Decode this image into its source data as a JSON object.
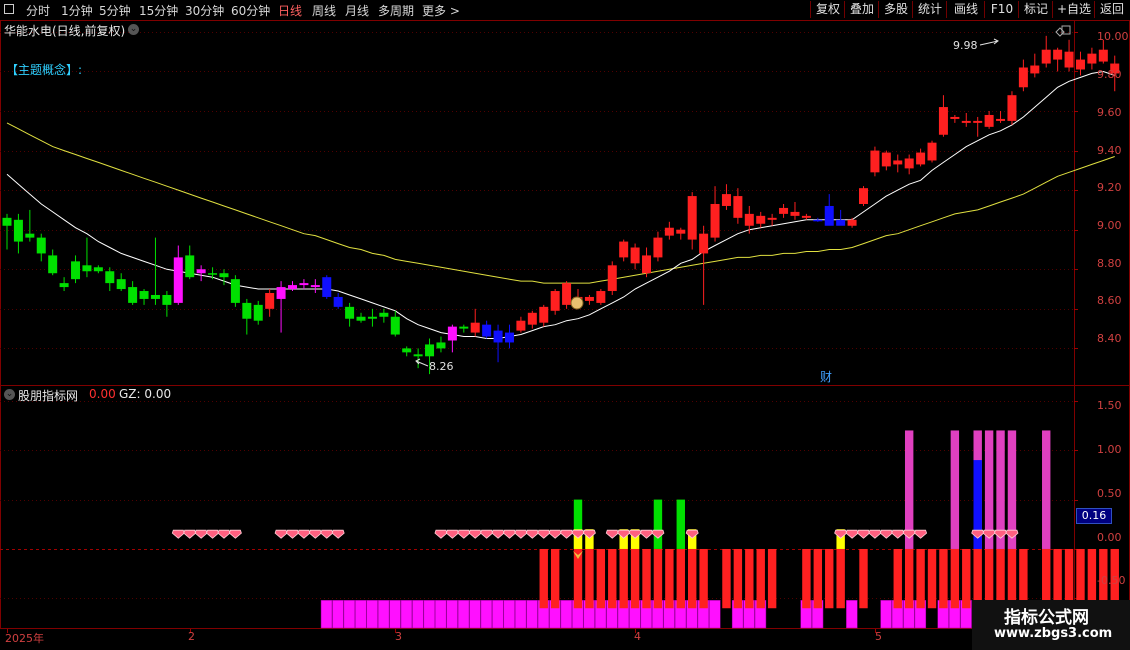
{
  "toolbar": {
    "periods": [
      "分时",
      "1分钟",
      "5分钟",
      "15分钟",
      "30分钟",
      "60分钟",
      "日线",
      "周线",
      "月线",
      "多周期",
      "更多 >"
    ],
    "active": "日线",
    "right_buttons": [
      "复权",
      "叠加",
      "多股",
      "统计",
      "画线",
      "F10",
      "标记",
      "+自选",
      "返回"
    ]
  },
  "header": {
    "title": "华能水电(日线,前复权)",
    "concept": "【主题概念】:"
  },
  "indicator": {
    "name": "股朋指标网",
    "value1": "0.00",
    "gz_label": "GZ: 0.00"
  },
  "axes": {
    "price_ticks": [
      "10.00",
      "9.80",
      "9.60",
      "9.40",
      "9.20",
      "9.00",
      "8.80",
      "8.60",
      "8.40"
    ],
    "ind_ticks": [
      "1.50",
      "1.00",
      "0.50",
      "0.00",
      "-0.50"
    ],
    "ind_current": "0.16",
    "date_labels": [
      "2025年",
      "2",
      "3",
      "4",
      "5"
    ]
  },
  "annotations": {
    "high": "9.98",
    "low": "8.26",
    "cai": "财"
  },
  "watermark": {
    "line1": "指标公式网",
    "line2": "www.zbgs3.com"
  },
  "colors": {
    "up": "#ff2020",
    "down": "#00e000",
    "ma_short": "#ffffff",
    "ma_long": "#e0e040",
    "magenta": "#ff10ff",
    "pink": "#e040c0",
    "blue": "#1010ff",
    "yellow": "#ffff00"
  },
  "chart_data": {
    "type": "candlestick",
    "price_range": [
      8.22,
      10.05
    ],
    "indicator_range": [
      -0.8,
      1.65
    ],
    "candles": [
      {
        "o": 9.06,
        "h": 9.08,
        "l": 8.9,
        "c": 9.02,
        "cat": "down"
      },
      {
        "o": 9.05,
        "h": 9.08,
        "l": 8.88,
        "c": 8.94,
        "cat": "down"
      },
      {
        "o": 8.98,
        "h": 9.1,
        "l": 8.94,
        "c": 8.96,
        "cat": "down"
      },
      {
        "o": 8.96,
        "h": 8.98,
        "l": 8.84,
        "c": 8.88,
        "cat": "down"
      },
      {
        "o": 8.87,
        "h": 8.9,
        "l": 8.77,
        "c": 8.78,
        "cat": "down"
      },
      {
        "o": 8.73,
        "h": 8.76,
        "l": 8.69,
        "c": 8.71,
        "cat": "down"
      },
      {
        "o": 8.84,
        "h": 8.87,
        "l": 8.73,
        "c": 8.75,
        "cat": "down"
      },
      {
        "o": 8.82,
        "h": 8.96,
        "l": 8.76,
        "c": 8.79,
        "cat": "down"
      },
      {
        "o": 8.81,
        "h": 8.82,
        "l": 8.78,
        "c": 8.79,
        "cat": "down"
      },
      {
        "o": 8.79,
        "h": 8.81,
        "l": 8.69,
        "c": 8.73,
        "cat": "down"
      },
      {
        "o": 8.75,
        "h": 8.78,
        "l": 8.69,
        "c": 8.7,
        "cat": "down"
      },
      {
        "o": 8.71,
        "h": 8.74,
        "l": 8.62,
        "c": 8.63,
        "cat": "down"
      },
      {
        "o": 8.69,
        "h": 8.7,
        "l": 8.62,
        "c": 8.65,
        "cat": "down"
      },
      {
        "o": 8.67,
        "h": 8.96,
        "l": 8.62,
        "c": 8.65,
        "cat": "down"
      },
      {
        "o": 8.67,
        "h": 8.69,
        "l": 8.56,
        "c": 8.62,
        "cat": "down"
      },
      {
        "o": 8.63,
        "h": 8.92,
        "l": 8.62,
        "c": 8.86,
        "cat": "pink"
      },
      {
        "o": 8.76,
        "h": 8.92,
        "l": 8.75,
        "c": 8.87,
        "cat": "down"
      },
      {
        "o": 8.78,
        "h": 8.82,
        "l": 8.74,
        "c": 8.8,
        "cat": "pink"
      },
      {
        "o": 8.78,
        "h": 8.81,
        "l": 8.75,
        "c": 8.78,
        "cat": "down"
      },
      {
        "o": 8.78,
        "h": 8.8,
        "l": 8.72,
        "c": 8.76,
        "cat": "down"
      },
      {
        "o": 8.75,
        "h": 8.77,
        "l": 8.61,
        "c": 8.63,
        "cat": "down"
      },
      {
        "o": 8.63,
        "h": 8.65,
        "l": 8.47,
        "c": 8.55,
        "cat": "down"
      },
      {
        "o": 8.62,
        "h": 8.64,
        "l": 8.52,
        "c": 8.54,
        "cat": "down"
      },
      {
        "o": 8.6,
        "h": 8.7,
        "l": 8.56,
        "c": 8.68,
        "cat": "up"
      },
      {
        "o": 8.65,
        "h": 8.74,
        "l": 8.48,
        "c": 8.71,
        "cat": "pink"
      },
      {
        "o": 8.7,
        "h": 8.74,
        "l": 8.69,
        "c": 8.72,
        "cat": "pink"
      },
      {
        "o": 8.72,
        "h": 8.75,
        "l": 8.7,
        "c": 8.73,
        "cat": "pink"
      },
      {
        "o": 8.71,
        "h": 8.75,
        "l": 8.68,
        "c": 8.72,
        "cat": "pink"
      },
      {
        "o": 8.76,
        "h": 8.77,
        "l": 8.65,
        "c": 8.66,
        "cat": "blue"
      },
      {
        "o": 8.66,
        "h": 8.68,
        "l": 8.6,
        "c": 8.61,
        "cat": "blue"
      },
      {
        "o": 8.61,
        "h": 8.63,
        "l": 8.51,
        "c": 8.55,
        "cat": "down"
      },
      {
        "o": 8.56,
        "h": 8.58,
        "l": 8.53,
        "c": 8.54,
        "cat": "down"
      },
      {
        "o": 8.56,
        "h": 8.6,
        "l": 8.51,
        "c": 8.55,
        "cat": "down"
      },
      {
        "o": 8.58,
        "h": 8.6,
        "l": 8.53,
        "c": 8.56,
        "cat": "down"
      },
      {
        "o": 8.56,
        "h": 8.59,
        "l": 8.46,
        "c": 8.47,
        "cat": "down"
      },
      {
        "o": 8.4,
        "h": 8.41,
        "l": 8.36,
        "c": 8.38,
        "cat": "down"
      },
      {
        "o": 8.37,
        "h": 8.4,
        "l": 8.3,
        "c": 8.36,
        "cat": "down"
      },
      {
        "o": 8.42,
        "h": 8.45,
        "l": 8.27,
        "c": 8.36,
        "cat": "down"
      },
      {
        "o": 8.4,
        "h": 8.46,
        "l": 8.38,
        "c": 8.43,
        "cat": "down"
      },
      {
        "o": 8.44,
        "h": 8.52,
        "l": 8.38,
        "c": 8.51,
        "cat": "pink"
      },
      {
        "o": 8.51,
        "h": 8.52,
        "l": 8.48,
        "c": 8.5,
        "cat": "down"
      },
      {
        "o": 8.48,
        "h": 8.6,
        "l": 8.46,
        "c": 8.53,
        "cat": "up"
      },
      {
        "o": 8.52,
        "h": 8.54,
        "l": 8.45,
        "c": 8.46,
        "cat": "blue"
      },
      {
        "o": 8.49,
        "h": 8.52,
        "l": 8.33,
        "c": 8.43,
        "cat": "blue"
      },
      {
        "o": 8.48,
        "h": 8.52,
        "l": 8.4,
        "c": 8.43,
        "cat": "blue"
      },
      {
        "o": 8.49,
        "h": 8.56,
        "l": 8.48,
        "c": 8.54,
        "cat": "up"
      },
      {
        "o": 8.52,
        "h": 8.59,
        "l": 8.5,
        "c": 8.58,
        "cat": "up"
      },
      {
        "o": 8.53,
        "h": 8.62,
        "l": 8.51,
        "c": 8.61,
        "cat": "up"
      },
      {
        "o": 8.59,
        "h": 8.7,
        "l": 8.57,
        "c": 8.69,
        "cat": "up"
      },
      {
        "o": 8.62,
        "h": 8.74,
        "l": 8.6,
        "c": 8.73,
        "cat": "up"
      },
      {
        "o": 8.66,
        "h": 8.7,
        "l": 8.62,
        "c": 8.64,
        "cat": "up"
      },
      {
        "o": 8.64,
        "h": 8.67,
        "l": 8.62,
        "c": 8.66,
        "cat": "up"
      },
      {
        "o": 8.63,
        "h": 8.7,
        "l": 8.62,
        "c": 8.69,
        "cat": "up"
      },
      {
        "o": 8.69,
        "h": 8.84,
        "l": 8.67,
        "c": 8.82,
        "cat": "up"
      },
      {
        "o": 8.86,
        "h": 8.95,
        "l": 8.84,
        "c": 8.94,
        "cat": "up"
      },
      {
        "o": 8.83,
        "h": 8.93,
        "l": 8.8,
        "c": 8.91,
        "cat": "up"
      },
      {
        "o": 8.87,
        "h": 8.91,
        "l": 8.76,
        "c": 8.78,
        "cat": "up"
      },
      {
        "o": 8.86,
        "h": 8.99,
        "l": 8.84,
        "c": 8.96,
        "cat": "up"
      },
      {
        "o": 8.97,
        "h": 9.04,
        "l": 8.95,
        "c": 9.01,
        "cat": "up"
      },
      {
        "o": 8.98,
        "h": 9.01,
        "l": 8.95,
        "c": 9.0,
        "cat": "up"
      },
      {
        "o": 8.95,
        "h": 9.19,
        "l": 8.9,
        "c": 9.17,
        "cat": "up"
      },
      {
        "o": 8.98,
        "h": 9.02,
        "l": 8.62,
        "c": 8.88,
        "cat": "up"
      },
      {
        "o": 8.96,
        "h": 9.22,
        "l": 8.94,
        "c": 9.13,
        "cat": "up"
      },
      {
        "o": 9.12,
        "h": 9.23,
        "l": 9.1,
        "c": 9.18,
        "cat": "up"
      },
      {
        "o": 9.17,
        "h": 9.21,
        "l": 9.03,
        "c": 9.06,
        "cat": "up"
      },
      {
        "o": 9.08,
        "h": 9.12,
        "l": 8.98,
        "c": 9.02,
        "cat": "up"
      },
      {
        "o": 9.07,
        "h": 9.09,
        "l": 9.01,
        "c": 9.03,
        "cat": "up"
      },
      {
        "o": 9.06,
        "h": 9.08,
        "l": 9.02,
        "c": 9.05,
        "cat": "up"
      },
      {
        "o": 9.08,
        "h": 9.13,
        "l": 9.06,
        "c": 9.11,
        "cat": "up"
      },
      {
        "o": 9.07,
        "h": 9.14,
        "l": 9.05,
        "c": 9.09,
        "cat": "up"
      },
      {
        "o": 9.06,
        "h": 9.08,
        "l": 9.05,
        "c": 9.07,
        "cat": "up"
      },
      {
        "o": 9.05,
        "h": 9.06,
        "l": 9.04,
        "c": 9.05,
        "cat": "blue"
      },
      {
        "o": 9.12,
        "h": 9.18,
        "l": 9.05,
        "c": 9.02,
        "cat": "blue"
      },
      {
        "o": 9.05,
        "h": 9.1,
        "l": 9.04,
        "c": 9.02,
        "cat": "blue"
      },
      {
        "o": 9.05,
        "h": 9.06,
        "l": 9.01,
        "c": 9.02,
        "cat": "up"
      },
      {
        "o": 9.13,
        "h": 9.22,
        "l": 9.12,
        "c": 9.21,
        "cat": "up"
      },
      {
        "o": 9.29,
        "h": 9.42,
        "l": 9.27,
        "c": 9.4,
        "cat": "up"
      },
      {
        "o": 9.32,
        "h": 9.4,
        "l": 9.3,
        "c": 9.39,
        "cat": "up"
      },
      {
        "o": 9.33,
        "h": 9.38,
        "l": 9.29,
        "c": 9.35,
        "cat": "up"
      },
      {
        "o": 9.31,
        "h": 9.38,
        "l": 9.28,
        "c": 9.36,
        "cat": "up"
      },
      {
        "o": 9.33,
        "h": 9.41,
        "l": 9.32,
        "c": 9.39,
        "cat": "up"
      },
      {
        "o": 9.35,
        "h": 9.45,
        "l": 9.34,
        "c": 9.44,
        "cat": "up"
      },
      {
        "o": 9.48,
        "h": 9.68,
        "l": 9.47,
        "c": 9.62,
        "cat": "up"
      },
      {
        "o": 9.56,
        "h": 9.58,
        "l": 9.54,
        "c": 9.57,
        "cat": "up"
      },
      {
        "o": 9.54,
        "h": 9.59,
        "l": 9.52,
        "c": 9.55,
        "cat": "up"
      },
      {
        "o": 9.54,
        "h": 9.57,
        "l": 9.47,
        "c": 9.55,
        "cat": "up"
      },
      {
        "o": 9.52,
        "h": 9.6,
        "l": 9.51,
        "c": 9.58,
        "cat": "up"
      },
      {
        "o": 9.56,
        "h": 9.6,
        "l": 9.54,
        "c": 9.55,
        "cat": "up"
      },
      {
        "o": 9.55,
        "h": 9.7,
        "l": 9.53,
        "c": 9.68,
        "cat": "up"
      },
      {
        "o": 9.72,
        "h": 9.86,
        "l": 9.7,
        "c": 9.82,
        "cat": "up"
      },
      {
        "o": 9.79,
        "h": 9.89,
        "l": 9.77,
        "c": 9.83,
        "cat": "up"
      },
      {
        "o": 9.84,
        "h": 9.98,
        "l": 9.82,
        "c": 9.91,
        "cat": "up"
      },
      {
        "o": 9.86,
        "h": 9.92,
        "l": 9.8,
        "c": 9.91,
        "cat": "up"
      },
      {
        "o": 9.82,
        "h": 9.96,
        "l": 9.8,
        "c": 9.9,
        "cat": "up"
      },
      {
        "o": 9.81,
        "h": 9.9,
        "l": 9.78,
        "c": 9.86,
        "cat": "up"
      },
      {
        "o": 9.84,
        "h": 9.92,
        "l": 9.81,
        "c": 9.89,
        "cat": "up"
      },
      {
        "o": 9.85,
        "h": 9.96,
        "l": 9.84,
        "c": 9.91,
        "cat": "up"
      },
      {
        "o": 9.84,
        "h": 9.88,
        "l": 9.7,
        "c": 9.79,
        "cat": "up"
      }
    ],
    "ma_short": [
      9.28,
      9.23,
      9.18,
      9.13,
      9.09,
      9.05,
      9.01,
      8.98,
      8.94,
      8.91,
      8.88,
      8.86,
      8.84,
      8.82,
      8.8,
      8.79,
      8.78,
      8.77,
      8.76,
      8.74,
      8.72,
      8.71,
      8.7,
      8.7,
      8.7,
      8.7,
      8.7,
      8.7,
      8.7,
      8.69,
      8.67,
      8.65,
      8.63,
      8.61,
      8.59,
      8.55,
      8.52,
      8.5,
      8.48,
      8.47,
      8.46,
      8.46,
      8.45,
      8.45,
      8.46,
      8.47,
      8.49,
      8.51,
      8.52,
      8.54,
      8.55,
      8.57,
      8.6,
      8.63,
      8.66,
      8.7,
      8.73,
      8.76,
      8.79,
      8.83,
      8.85,
      8.89,
      8.92,
      8.95,
      8.98,
      9.0,
      9.01,
      9.02,
      9.03,
      9.04,
      9.05,
      9.05,
      9.05,
      9.05,
      9.05,
      9.09,
      9.13,
      9.17,
      9.2,
      9.23,
      9.25,
      9.3,
      9.34,
      9.38,
      9.42,
      9.45,
      9.48,
      9.5,
      9.53,
      9.57,
      9.62,
      9.67,
      9.72,
      9.75,
      9.77,
      9.79,
      9.8,
      9.78
    ],
    "ma_long": [
      9.54,
      9.51,
      9.48,
      9.45,
      9.42,
      9.4,
      9.38,
      9.36,
      9.34,
      9.32,
      9.3,
      9.28,
      9.26,
      9.24,
      9.22,
      9.2,
      9.18,
      9.16,
      9.14,
      9.12,
      9.1,
      9.08,
      9.06,
      9.04,
      9.02,
      9.0,
      8.98,
      8.97,
      8.95,
      8.93,
      8.91,
      8.9,
      8.88,
      8.87,
      8.85,
      8.84,
      8.83,
      8.82,
      8.81,
      8.8,
      8.79,
      8.78,
      8.77,
      8.76,
      8.75,
      8.74,
      8.74,
      8.73,
      8.73,
      8.73,
      8.73,
      8.73,
      8.74,
      8.75,
      8.76,
      8.77,
      8.78,
      8.79,
      8.8,
      8.81,
      8.82,
      8.83,
      8.84,
      8.85,
      8.86,
      8.86,
      8.87,
      8.87,
      8.88,
      8.88,
      8.89,
      8.89,
      8.9,
      8.9,
      8.91,
      8.93,
      8.95,
      8.97,
      8.98,
      9.0,
      9.02,
      9.04,
      9.06,
      9.08,
      9.09,
      9.1,
      9.12,
      9.14,
      9.16,
      9.18,
      9.21,
      9.24,
      9.27,
      9.29,
      9.31,
      9.33,
      9.35,
      9.37
    ],
    "indicator_bars": [
      {
        "type": "magenta_low",
        "ranges": [
          [
            28,
            97
          ]
        ],
        "gaps": [
          63,
          67,
          68,
          69,
          72,
          73,
          75,
          76,
          81
        ]
      },
      {
        "type": "red_neg",
        "ranges": [
          [
            47,
            48
          ],
          [
            50,
            61
          ],
          [
            63,
            67
          ],
          [
            70,
            73
          ],
          [
            75,
            75
          ],
          [
            78,
            89
          ],
          [
            91,
            97
          ]
        ]
      },
      {
        "type": "gem_rows",
        "ranges": [
          [
            15,
            20
          ],
          [
            24,
            29
          ],
          [
            38,
            51
          ],
          [
            53,
            57
          ],
          [
            60,
            60
          ],
          [
            73,
            80
          ],
          [
            85,
            88
          ]
        ]
      },
      {
        "type": "green_pos",
        "indices": [
          50,
          57,
          59
        ],
        "values": [
          0.5,
          0.5,
          0.5
        ]
      },
      {
        "type": "yellow_pos",
        "indices": [
          50,
          51,
          54,
          55,
          60,
          73
        ],
        "values": [
          0.2,
          0.2,
          0.2,
          0.2,
          0.2,
          0.2
        ]
      },
      {
        "type": "pink_pos",
        "indices": [
          79,
          83,
          85,
          86,
          87,
          88,
          91
        ],
        "values": [
          1.2,
          1.2,
          1.2,
          1.2,
          1.2,
          1.2,
          1.2
        ]
      },
      {
        "type": "blue_pos",
        "indices": [
          85
        ],
        "values": [
          0.9
        ]
      }
    ]
  }
}
